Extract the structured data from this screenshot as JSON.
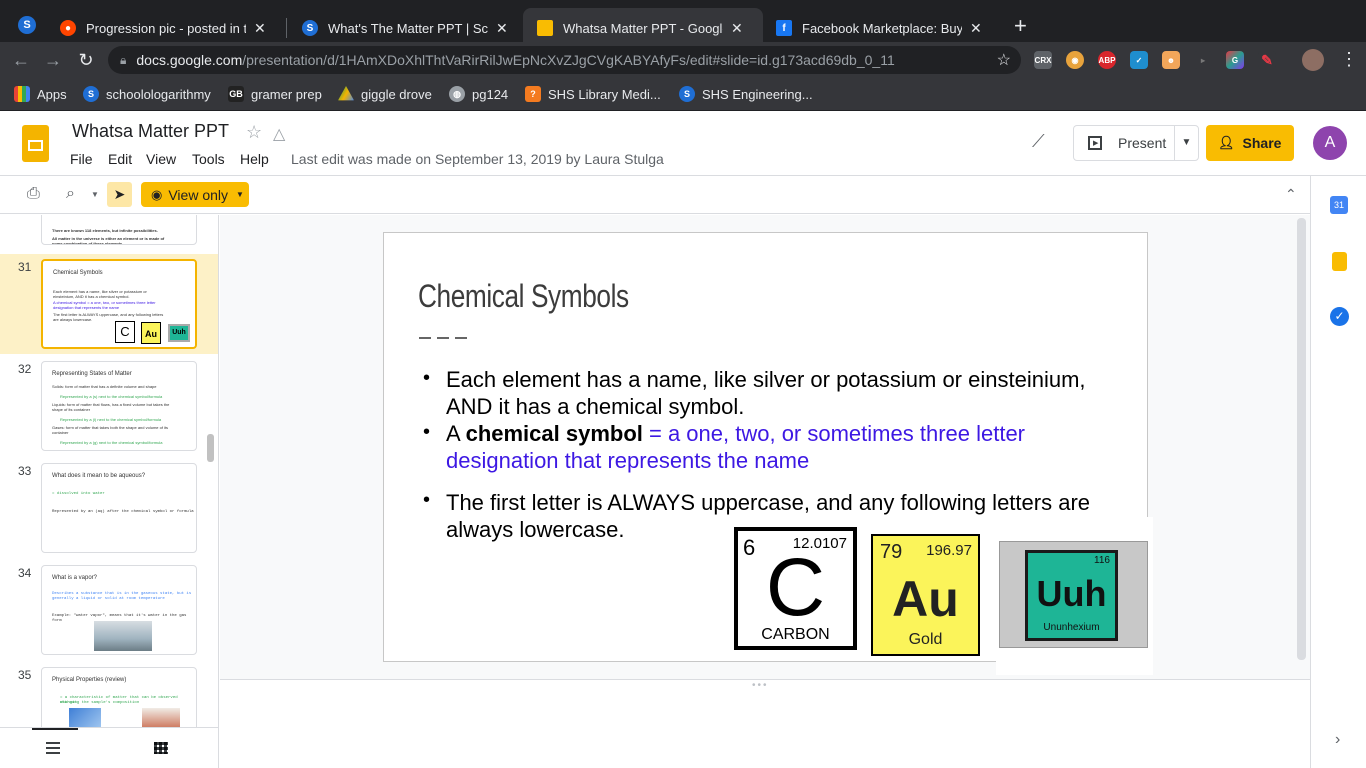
{
  "browser": {
    "tabs": [
      {
        "title": "Progression pic - posted in the",
        "icon": "reddit-icon",
        "color": "#ff4500"
      },
      {
        "title": "What's The Matter PPT | Schoo",
        "icon": "schoology-icon",
        "color": "#1f6ed4"
      },
      {
        "title": "Whatsa Matter PPT - Google Sl",
        "icon": "google-slides-icon",
        "color": "#f9bc02"
      },
      {
        "title": "Facebook Marketplace: Buy an",
        "icon": "facebook-icon",
        "color": "#1877f2"
      }
    ],
    "url_host": "docs.google.com",
    "url_path": "/presentation/d/1HAmXDoXhlThtVaRirRilJwEpNcXvZJgCVgKABYAfyFs/edit#slide=id.g173acd69db_0_11",
    "bookmarks": [
      {
        "label": "Apps",
        "icon": "apps-grid-icon"
      },
      {
        "label": "schoolologarithmy",
        "icon": "schoology-icon"
      },
      {
        "label": "gramer prep",
        "icon": "gb-icon"
      },
      {
        "label": "giggle drove",
        "icon": "google-drive-icon"
      },
      {
        "label": "pg124",
        "icon": "globe-icon"
      },
      {
        "label": "SHS Library Medi...",
        "icon": "library-icon"
      },
      {
        "label": "SHS Engineering...",
        "icon": "schoology-icon"
      }
    ],
    "extensions": [
      "CRX",
      "ABP"
    ]
  },
  "docs": {
    "title": "Whatsa Matter PPT",
    "menu": [
      "File",
      "Edit",
      "View",
      "Tools",
      "Help"
    ],
    "last_edit": "Last edit was made on September 13, 2019 by Laura Stulga",
    "present_label": "Present",
    "share_label": "Share",
    "avatar_letter": "A",
    "view_only_label": "View only"
  },
  "filmstrip": [
    {
      "num": "31",
      "title": "Chemical Symbols",
      "lines": [
        "Each element has a name, like silver or potassium or",
        "einsteinium, AND it has a chemical symbol.",
        "A chemical symbol = a one, two, or sometimes three letter",
        "designation that represents the name",
        "The first letter is ALWAYS uppercase, and any following letters",
        "are always lowercase."
      ],
      "selected": true
    },
    {
      "num": "32",
      "title": "Representing States of Matter",
      "lines": [
        "Solids: form of matter that has a definite volume and shape",
        "Represented by a (s) next to the chemical symbol/formula",
        "Liquids: form of matter that flows, has a fixed volume but takes the",
        "shape of its container",
        "Represented by a (l) next to the chemical symbol/formula",
        "Gases: form of matter that takes both the shape and volume of its",
        "container",
        "Represented by a (g) next to the chemical symbol/formula"
      ]
    },
    {
      "num": "33",
      "title": "What does it mean to be aqueous?",
      "lines": [
        "= dissolved into water",
        "Represented by an (aq) after the chemical symbol or formula"
      ]
    },
    {
      "num": "34",
      "title": "What is a vapor?",
      "lines": [
        "Describes a substance that is in the gaseous state, but is",
        "generally a liquid or solid at room temperature",
        "Example: \"water vapor\", means that it's water in the gas",
        "form"
      ]
    },
    {
      "num": "35",
      "title": "Physical Properties (review)",
      "lines": [
        "= a characteristic of matter that can be observed without",
        "changing the sample's composition"
      ]
    }
  ],
  "slide": {
    "title": "Chemical Symbols",
    "bullet1": "Each element has a name, like silver or potassium or einsteinium, AND it has a chemical symbol.",
    "bullet2_lead": "A ",
    "bullet2_bold": "chemical symbol",
    "bullet2_def": " = a one, two, or sometimes three letter designation that represents the name",
    "bullet3": "The first letter is ALWAYS uppercase, and any following letters are always lowercase.",
    "elements": [
      {
        "number": "6",
        "mass": "12.0107",
        "symbol": "C",
        "name": "CARBON",
        "bg": "#ffffff"
      },
      {
        "number": "79",
        "mass": "196.97",
        "symbol": "Au",
        "name": "Gold",
        "bg": "#fbf45a"
      },
      {
        "number": "116",
        "mass": "",
        "symbol": "Uuh",
        "name": "Ununhexium",
        "bg": "#1eb596"
      }
    ],
    "thumb_tiles": [
      "C",
      "Au",
      "Uuh"
    ]
  }
}
